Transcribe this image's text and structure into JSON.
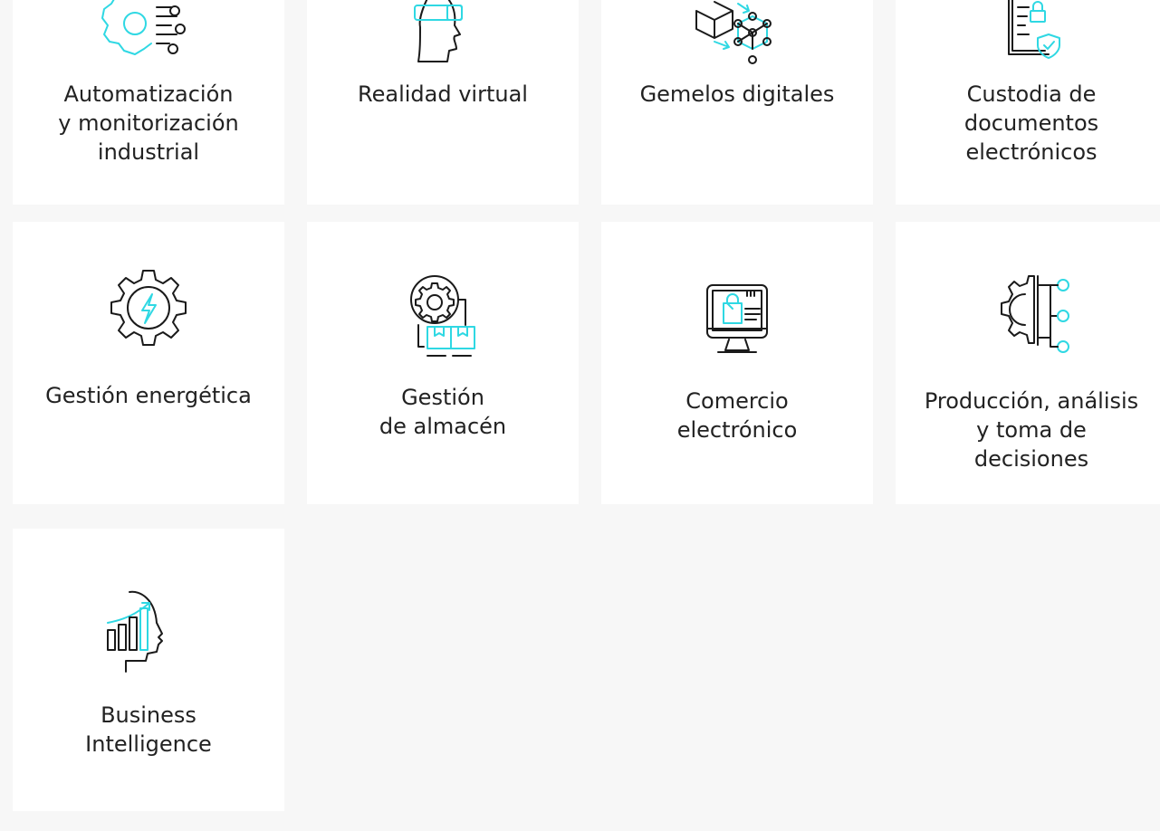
{
  "colors": {
    "background": "#f7f7f7",
    "card": "#ffffff",
    "accent": "#2fd8e3",
    "ink": "#1a1a1a"
  },
  "cards": [
    {
      "icon": "gear-network-icon",
      "label": "Automatización\ny monitorización\nindustrial"
    },
    {
      "icon": "vr-headset-icon",
      "label": "Realidad virtual"
    },
    {
      "icon": "digital-twin-icon",
      "label": "Gemelos digitales"
    },
    {
      "icon": "secure-document-icon",
      "label": "Custodia de\ndocumentos\nelectrónicos"
    },
    {
      "icon": "energy-gear-icon",
      "label": "Gestión energética"
    },
    {
      "icon": "warehouse-gear-icon",
      "label": "Gestión\nde almacén"
    },
    {
      "icon": "ecommerce-monitor-icon",
      "label": "Comercio\nelectrónico"
    },
    {
      "icon": "decision-gear-icon",
      "label": "Producción, análisis\ny toma de\ndecisiones"
    },
    {
      "icon": "business-intelligence-icon",
      "label": "Business\nIntelligence"
    }
  ]
}
